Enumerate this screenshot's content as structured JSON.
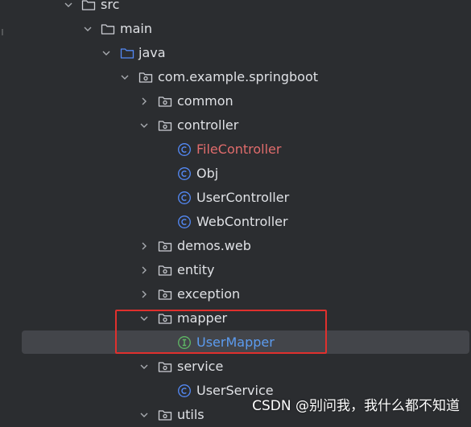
{
  "colors": {
    "background": "#2b2d30",
    "text": "#dfe1e5",
    "selection": "#43454a",
    "highlight_box": "#e0302d",
    "error_text": "#e06c6c",
    "selected_text": "#5c9cf0"
  },
  "tree": {
    "items": [
      {
        "label": "src",
        "icon": "folder-icon",
        "expanded": true
      },
      {
        "label": "main",
        "icon": "folder-icon",
        "expanded": true
      },
      {
        "label": "java",
        "icon": "source-folder-icon",
        "expanded": true
      },
      {
        "label": "com.example.springboot",
        "icon": "package-icon",
        "expanded": true
      },
      {
        "label": "common",
        "icon": "package-icon",
        "expanded": false
      },
      {
        "label": "controller",
        "icon": "package-icon",
        "expanded": true
      },
      {
        "label": "FileController",
        "icon": "class-icon",
        "status": "error"
      },
      {
        "label": "Obj",
        "icon": "class-icon"
      },
      {
        "label": "UserController",
        "icon": "class-icon"
      },
      {
        "label": "WebController",
        "icon": "class-icon"
      },
      {
        "label": "demos.web",
        "icon": "package-icon",
        "expanded": false
      },
      {
        "label": "entity",
        "icon": "package-icon",
        "expanded": false
      },
      {
        "label": "exception",
        "icon": "package-icon",
        "expanded": false
      },
      {
        "label": "mapper",
        "icon": "package-icon",
        "expanded": true
      },
      {
        "label": "UserMapper",
        "icon": "interface-icon",
        "selected": true
      },
      {
        "label": "service",
        "icon": "package-icon",
        "expanded": true
      },
      {
        "label": "UserService",
        "icon": "class-icon"
      },
      {
        "label": "utils",
        "icon": "package-icon",
        "expanded": true
      }
    ]
  },
  "watermark": "CSDN @别问我，我什么都不知道"
}
